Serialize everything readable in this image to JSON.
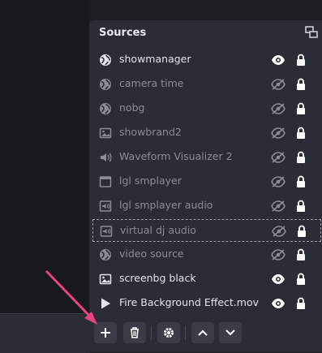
{
  "dock": {
    "title": "Sources"
  },
  "sources": [
    {
      "name": "showmanager",
      "icon": "globe-icon",
      "visible": true,
      "locked": true
    },
    {
      "name": "camera time",
      "icon": "globe-icon",
      "visible": false,
      "locked": true
    },
    {
      "name": "nobg",
      "icon": "globe-icon",
      "visible": false,
      "locked": true
    },
    {
      "name": "showbrand2",
      "icon": "image-icon",
      "visible": false,
      "locked": true
    },
    {
      "name": "Waveform Visualizer 2",
      "icon": "speaker-icon",
      "visible": false,
      "locked": true
    },
    {
      "name": "lgl smplayer",
      "icon": "window-icon",
      "visible": false,
      "locked": true
    },
    {
      "name": "lgl smplayer audio",
      "icon": "audio-window-icon",
      "visible": false,
      "locked": true
    },
    {
      "name": "virtual dj audio",
      "icon": "audio-window-icon",
      "visible": false,
      "locked": true,
      "selected": true
    },
    {
      "name": "video source",
      "icon": "globe-icon",
      "visible": false,
      "locked": true
    },
    {
      "name": "screenbg black",
      "icon": "image-icon",
      "visible": true,
      "locked": true
    },
    {
      "name": "Fire Background Effect.mov",
      "icon": "play-icon",
      "visible": true,
      "locked": true
    }
  ],
  "toolbar": {
    "buttons": [
      "add-source-button",
      "remove-source-button",
      "source-properties-button",
      "move-up-button",
      "move-down-button"
    ]
  },
  "colors": {
    "panel": "#2b2d36",
    "annotation_arrow": "#e8437f"
  }
}
